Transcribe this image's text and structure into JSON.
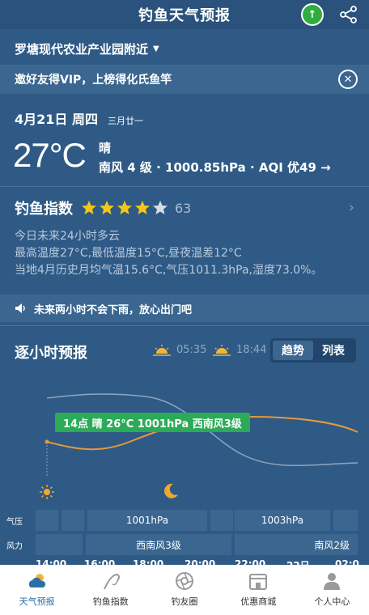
{
  "header": {
    "title": "钓鱼天气预报",
    "vip_badge": "↑"
  },
  "location": {
    "name": "罗塘现代农业产业园附近",
    "caret": "▼"
  },
  "promo": {
    "text": "邀好友得VIP，上榜得化氏鱼竿",
    "close": "✕"
  },
  "today": {
    "date": "4月21日 周四",
    "lunar": "三月廿一",
    "temperature": "27°C",
    "condition": "晴",
    "details": "南风 4 级 · 1000.85hPa · AQI 优49 →"
  },
  "fishing": {
    "label": "钓鱼指数",
    "stars": 4,
    "max_stars": 5,
    "score": "63",
    "lines": [
      "今日未来24小时多云",
      "最高温度27°C,最低温度15°C,昼夜温差12°C",
      "当地4月历史月均气温15.6°C,气压1011.3hPa,湿度73.0%。"
    ]
  },
  "notice": {
    "text": "未来两小时不会下雨，放心出门吧"
  },
  "hourly": {
    "title": "逐小时预报",
    "sunrise": "05:35",
    "sunset": "18:44",
    "tabs": [
      {
        "label": "趋势",
        "active": true
      },
      {
        "label": "列表",
        "active": false
      }
    ],
    "tooltip": "14点 晴 26°C 1001hPa 西南风3级",
    "rows": {
      "pressure_label": "气压",
      "wind_label": "风力",
      "pressure_cells": [
        "",
        "",
        "1001hPa",
        "",
        "1003hPa",
        ""
      ],
      "wind_cells": [
        "",
        "西南风3级",
        "南风2级"
      ]
    },
    "times": [
      "14:00",
      "16:00",
      "18:00",
      "20:00",
      "22:00",
      "22日",
      "02:0"
    ]
  },
  "colors": {
    "background": "#2f5a86",
    "temp_line": "#e39a3a",
    "pressure_line": "#8ea6bf",
    "tooltip": "#2bab57",
    "star": "#f5c518",
    "nav_active": "#2c6ea8"
  },
  "nav": [
    {
      "label": "天气预报",
      "icon": "weather-icon",
      "active": true
    },
    {
      "label": "钓鱼指数",
      "icon": "fishing-rod-icon",
      "active": false
    },
    {
      "label": "钓友圈",
      "icon": "camera-aperture-icon",
      "active": false
    },
    {
      "label": "优惠商城",
      "icon": "shop-icon",
      "active": false
    },
    {
      "label": "个人中心",
      "icon": "user-icon",
      "active": false
    }
  ]
}
